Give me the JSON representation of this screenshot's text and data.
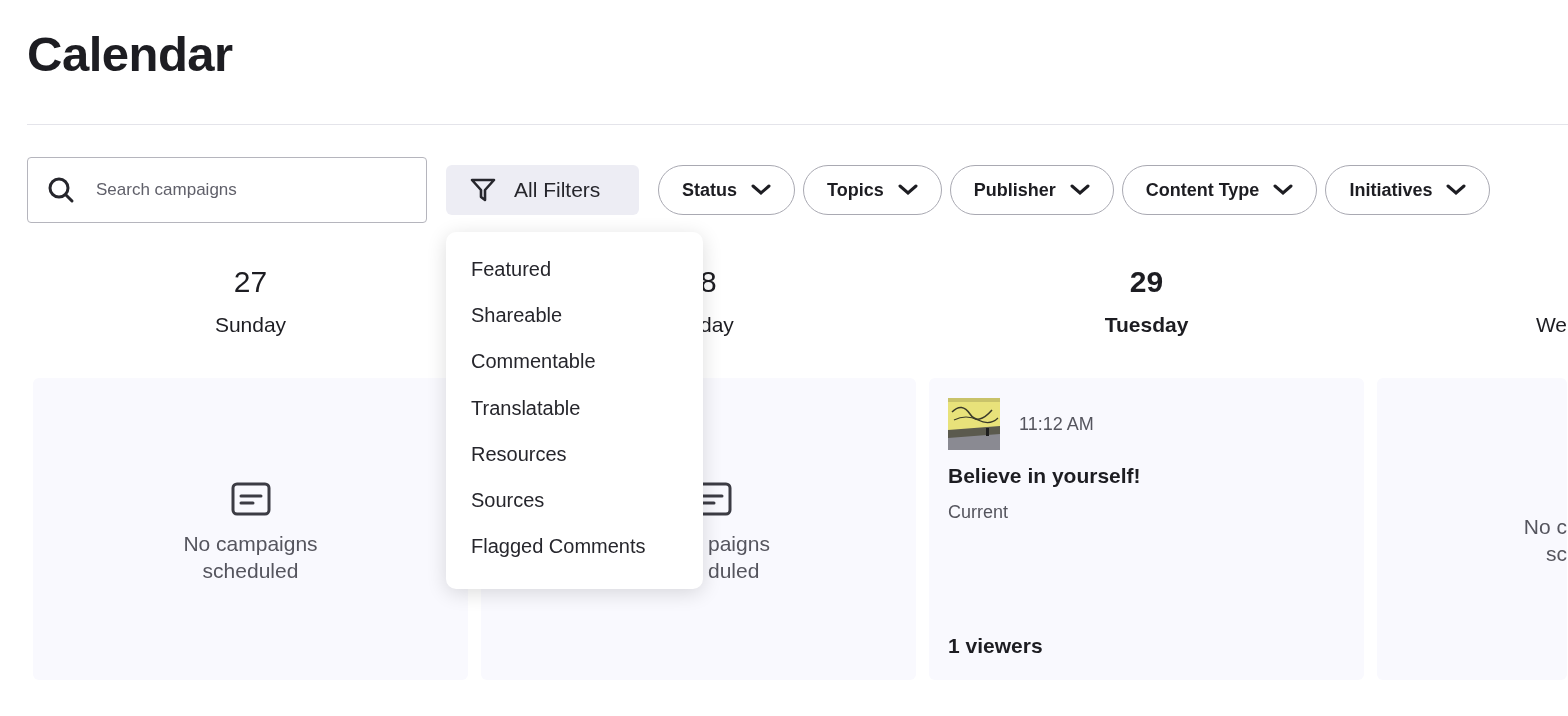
{
  "title": "Calendar",
  "search": {
    "placeholder": "Search campaigns"
  },
  "all_filters": {
    "label": "All Filters",
    "expanded": true
  },
  "filters": [
    {
      "label": "Status"
    },
    {
      "label": "Topics"
    },
    {
      "label": "Publisher"
    },
    {
      "label": "Content Type"
    },
    {
      "label": "Initiatives"
    }
  ],
  "filter_menu": [
    "Featured",
    "Shareable",
    "Commentable",
    "Translatable",
    "Resources",
    "Sources",
    "Flagged Comments"
  ],
  "days": [
    {
      "kind": "full",
      "number": "27",
      "name": "Sunday",
      "selected": false,
      "card": {
        "kind": "empty",
        "lines": [
          "No campaigns",
          "scheduled"
        ]
      }
    },
    {
      "kind": "covered",
      "number": "8",
      "name": "day",
      "selected": false,
      "card": {
        "kind": "empty",
        "lines": [
          "paigns",
          "duled"
        ]
      }
    },
    {
      "kind": "full",
      "number": "29",
      "name": "Tuesday",
      "selected": true,
      "card": {
        "kind": "campaign",
        "time": "11:12 AM",
        "title": "Believe in yourself!",
        "status": "Current",
        "viewers": "1 viewers"
      }
    },
    {
      "kind": "clipped",
      "name": "We",
      "selected": false,
      "card": {
        "kind": "empty",
        "lines": [
          "No c",
          "sc"
        ]
      }
    }
  ]
}
